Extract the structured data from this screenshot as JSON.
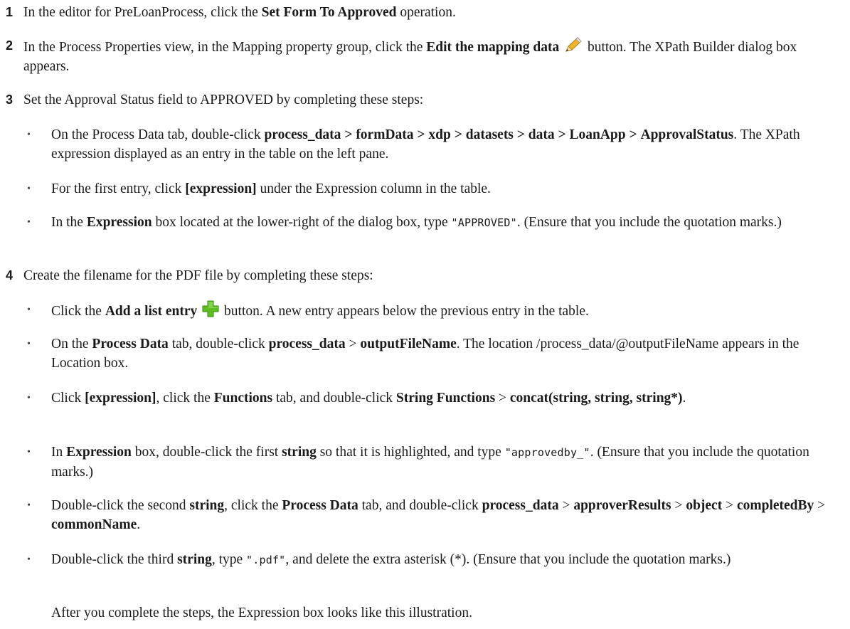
{
  "steps": [
    {
      "num": "1",
      "html": "In the editor for PreLoanProcess, click the <b>Set Form To Approved</b> operation."
    },
    {
      "num": "2",
      "html": "In the Process Properties view, in the Mapping property group, click the <b>Edit the mapping data</b> {{pencil}} button. The XPath Builder dialog box appears."
    },
    {
      "num": "3",
      "html": "Set the Approval Status field to APPROVED by completing these steps:"
    },
    {
      "num": "4",
      "html": "Create the filename for the PDF file by completing these steps:"
    }
  ],
  "bullets3": [
    "On the Process Data tab, double-click <b>process_data</b> <b>&gt;</b> <b>formData</b> <b>&gt;</b> <b>xdp</b> <b>&gt;</b> <b>datasets</b> <b>&gt;</b> <b>data</b> <b>&gt;</b> <b>LoanApp</b> <b>&gt;</b> <b>ApprovalStatus</b>. The XPath expression displayed as an entry in the table on the left pane.",
    "For the first entry, click <b>[expression]</b> under the Expression column in the table.",
    "In the <b>Expression</b> box located at the lower-right of the dialog box, type <span class=\"code\">\"APPROVED\"</span>. (Ensure that you include the quotation marks.)"
  ],
  "bullets4": [
    "Click the <b>Add a list entry</b> {{plus}} button. A new entry appears below the previous entry in the table.",
    "On the <b>Process Data</b> tab, double-click <b>process_data</b> &gt; <b>outputFileName</b>. The location /process_data/@outputFileName appears in the Location box.",
    "Click <b>[expression]</b>, click the <b>Functions</b> tab, and double-click <b>String Functions</b> &gt; <b>concat(string, string, string*)</b>.",
    "In <b>Expression</b> box, double-click the first <b>string</b> so that it is highlighted, and type <span class=\"code\">\"approvedby_\"</span>. (Ensure that you include the quotation marks.)",
    "Double-click the second <b>string</b>, click the <b>Process Data</b> tab, and double-click <b>process_data</b> &gt; <b>approverResults</b> &gt; <b>object</b> &gt; <b>completedBy</b> &gt; <b>commonName</b>.",
    "Double-click the third <b>string</b>, type <span class=\"code\">\".pdf\"</span>, and delete the extra asterisk (*). (Ensure that you include the quotation marks.)"
  ],
  "after_text": "After you complete the steps, the Expression box looks like this illustration.",
  "icons": {
    "pencil": "pencil-icon",
    "plus": "plus-icon",
    "plus_color": "#5bbf1f",
    "pencil_color": "#f0b429"
  }
}
